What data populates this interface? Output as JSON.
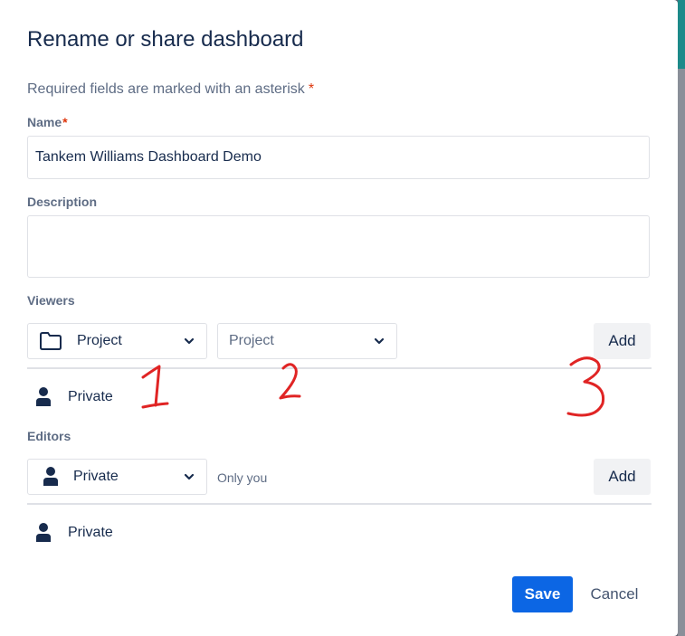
{
  "dialog": {
    "title": "Rename or share dashboard",
    "required_note": "Required fields are marked with an asterisk",
    "required_marker": "*"
  },
  "fields": {
    "name": {
      "label": "Name",
      "value": "Tankem Williams Dashboard Demo"
    },
    "description": {
      "label": "Description",
      "value": ""
    }
  },
  "viewers": {
    "label": "Viewers",
    "type_select": {
      "value": "Project",
      "icon": "folder-icon"
    },
    "project_select": {
      "placeholder": "Project"
    },
    "add_label": "Add",
    "current": {
      "label": "Private",
      "icon": "person-icon"
    }
  },
  "editors": {
    "label": "Editors",
    "type_select": {
      "value": "Private",
      "icon": "person-icon"
    },
    "hint": "Only you",
    "add_label": "Add",
    "current": {
      "label": "Private",
      "icon": "person-icon"
    }
  },
  "footer": {
    "save_label": "Save",
    "cancel_label": "Cancel"
  },
  "annotations": {
    "marks": [
      "1",
      "2",
      "3"
    ],
    "color": "#e02424"
  },
  "colors": {
    "primary": "#0c66e4",
    "required": "#de350b",
    "text": "#172b4d",
    "subtle": "#5e6c84"
  }
}
